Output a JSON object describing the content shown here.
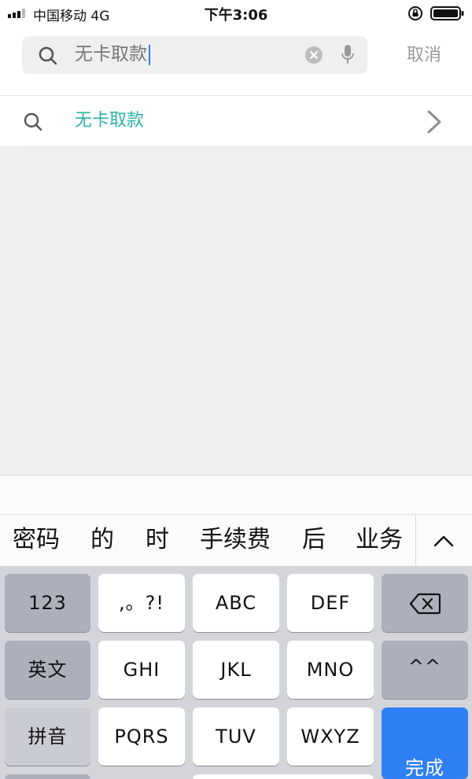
{
  "status_bar": {
    "carrier": "中国移动  4G",
    "time": "下午3:06",
    "icons": [
      "signal-icon",
      "rotation-lock-icon",
      "battery-icon"
    ]
  },
  "search": {
    "query": "无卡取款",
    "cancel_label": "取消",
    "icons": [
      "search-icon",
      "clear-icon",
      "microphone-icon"
    ]
  },
  "suggestions": [
    {
      "text": "无卡取款",
      "icons": [
        "search-icon",
        "chevron-right-icon"
      ]
    }
  ],
  "keyboard": {
    "candidates": [
      "密码",
      "的",
      "时",
      "手续费",
      "后",
      "业务"
    ],
    "collapse_icon": "chevron-up-icon",
    "rows": [
      [
        "123",
        ",。?!",
        "ABC",
        "DEF",
        "delete-icon"
      ],
      [
        "英文",
        "GHI",
        "JKL",
        "MNO",
        "^^"
      ],
      [
        "拼音",
        "PQRS",
        "TUV",
        "WXYZ",
        "完成"
      ]
    ],
    "keys": {
      "num": "123",
      "punct": ",。?!",
      "abc": "ABC",
      "def": "DEF",
      "english": "英文",
      "ghi": "GHI",
      "jkl": "JKL",
      "mno": "MNO",
      "emoticon": "^^",
      "pinyin": "拼音",
      "pqrs": "PQRS",
      "tuv": "TUV",
      "wxyz": "WXYZ",
      "done": "完成"
    },
    "accent_color": "#2f80f7"
  },
  "colors": {
    "suggestion_text": "#2ab3a6",
    "caret": "#3478f6",
    "cancel_text": "#9a9a9a"
  }
}
